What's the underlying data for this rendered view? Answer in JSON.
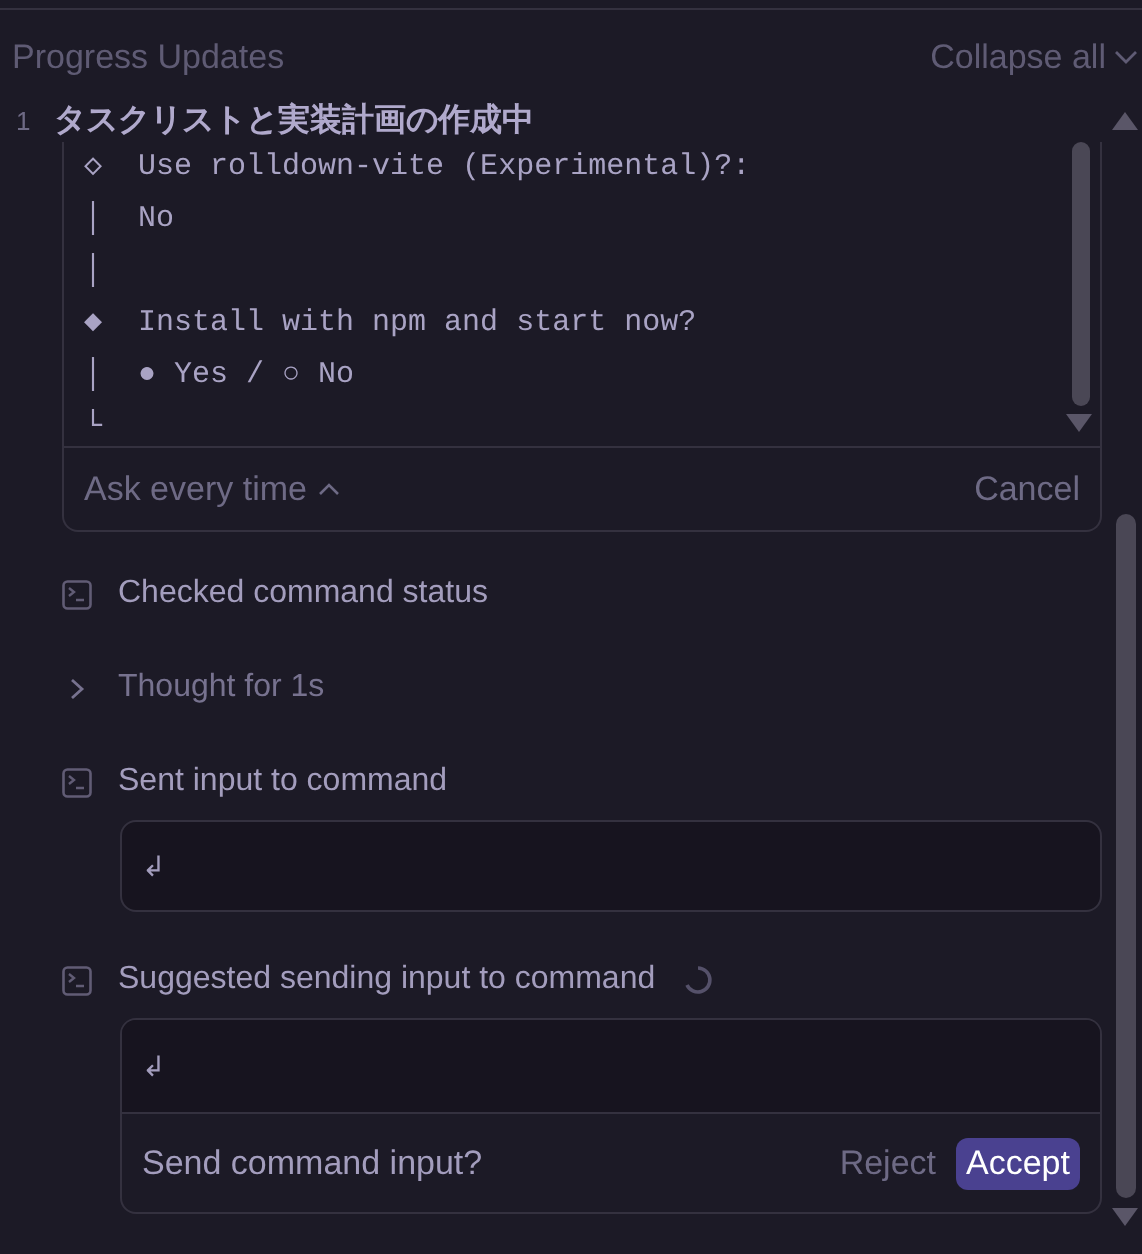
{
  "header": {
    "title": "Progress Updates",
    "collapse_label": "Collapse all"
  },
  "step": {
    "number": "1",
    "title": "タスクリストと実装計画の作成中"
  },
  "terminal": {
    "lines": [
      "◇  Use rolldown-vite (Experimental)?:",
      "│  No",
      "│",
      "◆  Install with npm and start now?",
      "│  ● Yes / ○ No",
      "└"
    ],
    "policy_label": "Ask every time",
    "cancel_label": "Cancel"
  },
  "items": [
    {
      "kind": "command",
      "label": "Checked command status",
      "pending": false
    },
    {
      "kind": "thought",
      "label": "Thought for 1s",
      "pending": false
    },
    {
      "kind": "command",
      "label": "Sent input to command",
      "pending": false,
      "input": "↲"
    },
    {
      "kind": "command",
      "label": "Suggested sending input to command",
      "pending": true,
      "input": "↲",
      "prompt": {
        "question": "Send command input?",
        "reject": "Reject",
        "accept": "Accept"
      }
    }
  ]
}
